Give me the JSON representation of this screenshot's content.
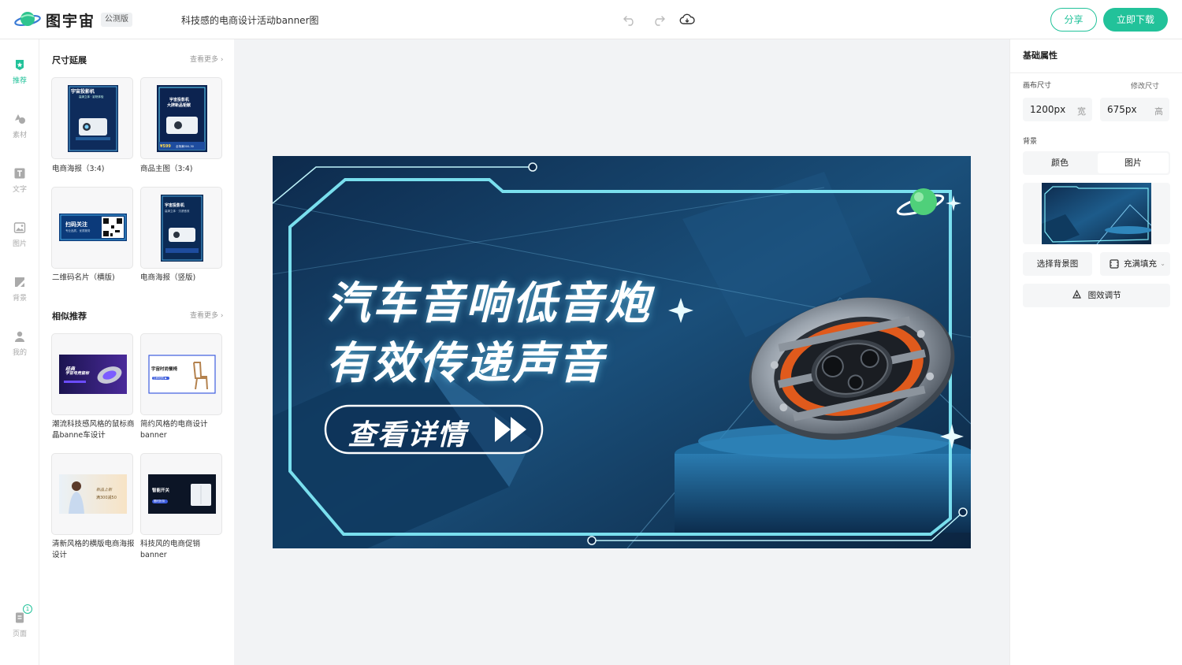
{
  "app": {
    "brand": "图宇宙",
    "beta_badge": "公测版",
    "document_title": "科技感的电商设计活动banner图",
    "share_label": "分享",
    "download_label": "立即下载",
    "accent_color": "#22c29a"
  },
  "toolbar_icons": [
    "undo-icon",
    "redo-icon",
    "cloud-save-icon"
  ],
  "nav": {
    "items": [
      {
        "label": "推荐",
        "icon": "recommend-icon",
        "active": true
      },
      {
        "label": "素材",
        "icon": "shapes-icon"
      },
      {
        "label": "文字",
        "icon": "text-icon"
      },
      {
        "label": "图片",
        "icon": "image-icon"
      },
      {
        "label": "背景",
        "icon": "background-icon"
      },
      {
        "label": "我的",
        "icon": "user-icon"
      }
    ],
    "pages_label": "页面",
    "pages_count": "1"
  },
  "panel": {
    "section1_title": "尺寸延展",
    "section1_more": "查看更多",
    "section1_items": [
      {
        "caption": "电商海报（3:4)"
      },
      {
        "caption": "商品主图（3:4)"
      },
      {
        "caption": "二维码名片（横版)"
      },
      {
        "caption": "电商海报（竖版)"
      }
    ],
    "section2_title": "相似推荐",
    "section2_more": "查看更多",
    "section2_items": [
      {
        "caption": "潮流科技感风格的鼠标商晶banne车设计"
      },
      {
        "caption": "简约风格的电商设计banner"
      },
      {
        "caption": "清新风格的横版电商海报设计"
      },
      {
        "caption": "科技风的电商促销banner"
      }
    ],
    "thumb_texts": {
      "projector_title": "宇宙投影机",
      "projector_sub": "高清立体 · 影院体验",
      "product_title1": "宇宙投影机",
      "product_title2": "大牌新品钜献",
      "product_price": "¥599",
      "product_promo": "全场满300-30",
      "qr_title": "扫码关注",
      "qr_sub": "专业品质，优质服务",
      "poster2_title": "宇宙投影机",
      "poster2_sub": "高清立体 · 沉浸音效",
      "mouse_title1": "经典",
      "mouse_title2": "宇宙电竞鼠标",
      "chair_title": "宇宙时尚餐椅",
      "chair_sub": "立即抢购 ▶",
      "fresh_title": "新品上新",
      "fresh_price": "满300减50",
      "switch_title": "智能开关",
      "switch_sub": "限时折扣"
    }
  },
  "canvas": {
    "headline_line1": "汽车音响低音炮",
    "headline_line2": "有效传递声音",
    "cta_label": "查看详情",
    "cta_icon": "fast-forward-icon",
    "product": "car-speaker-image",
    "bg_color": "#0f2f52",
    "frame_color": "#7fe8f5"
  },
  "props": {
    "title": "基础属性",
    "canvas_size_label": "画布尺寸",
    "resize_label": "修改尺寸",
    "width_value": "1200px",
    "width_unit": "宽",
    "height_value": "675px",
    "height_unit": "高",
    "background_label": "背景",
    "tab_color": "颜色",
    "tab_image": "图片",
    "active_tab": "图片",
    "choose_bg_label": "选择背景图",
    "fill_mode_label": "充满填充",
    "effects_label": "图效调节"
  }
}
